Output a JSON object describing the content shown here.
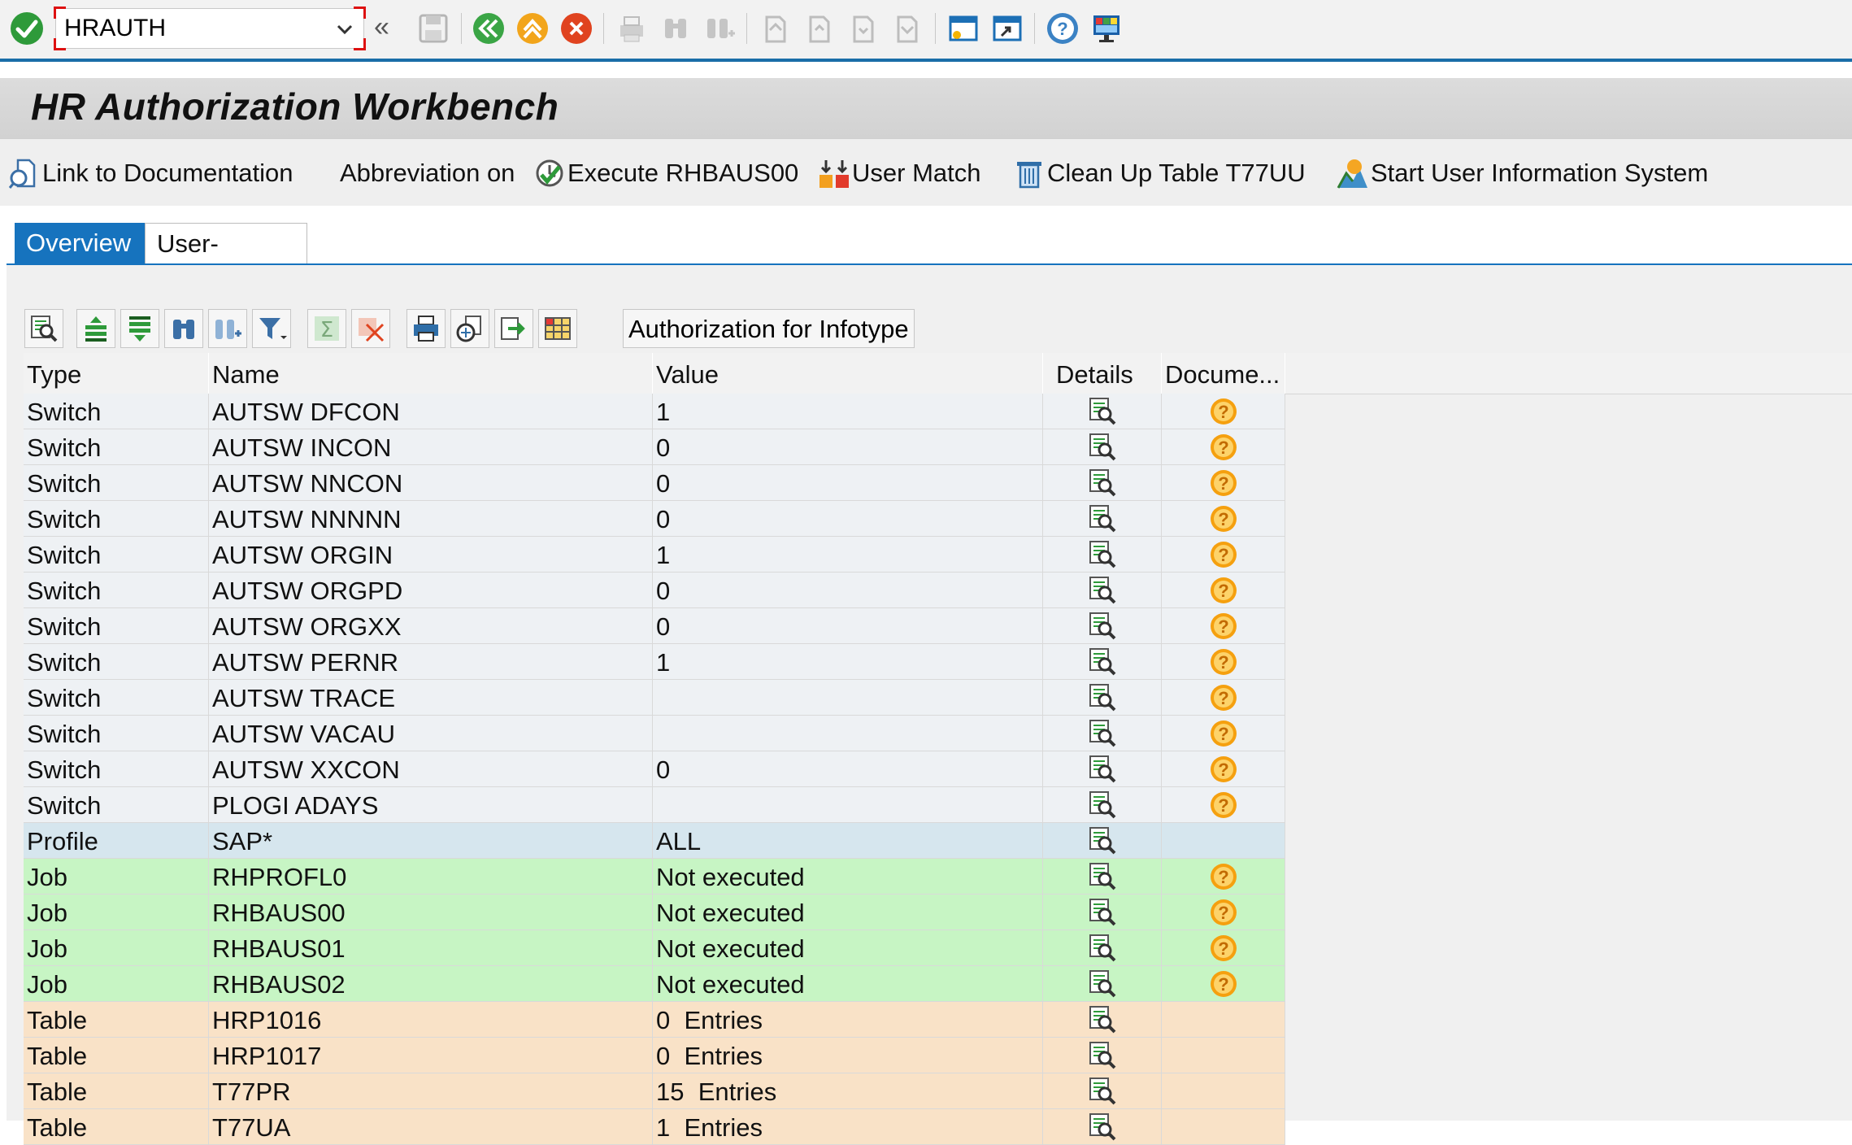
{
  "command_field": {
    "value": "HRAUTH"
  },
  "title": "HR Authorization Workbench",
  "app_toolbar": [
    {
      "label": "Link to Documentation",
      "icon": "link-doc-icon"
    },
    {
      "label": "Abbreviation on",
      "icon": ""
    },
    {
      "label": "Execute RHBAUS00",
      "icon": "execute-icon"
    },
    {
      "label": "User Match",
      "icon": "user-match-icon"
    },
    {
      "label": "Clean Up Table T77UU",
      "icon": "trash-icon"
    },
    {
      "label": "Start User Information System",
      "icon": "user-info-system-icon"
    }
  ],
  "tabs": [
    {
      "label": "Overview",
      "active": true
    },
    {
      "label": "User-specific",
      "active": false
    }
  ],
  "alv_toolbar": {
    "button_label": "Authorization for Infotype"
  },
  "grid": {
    "columns": [
      "Type",
      "Name",
      "Value",
      "Details",
      "Docume..."
    ],
    "rows": [
      {
        "type": "Switch",
        "name": "AUTSW DFCON",
        "value": "1",
        "doc": true,
        "status": "switch"
      },
      {
        "type": "Switch",
        "name": "AUTSW INCON",
        "value": "0",
        "doc": true,
        "status": "switch"
      },
      {
        "type": "Switch",
        "name": "AUTSW NNCON",
        "value": "0",
        "doc": true,
        "status": "switch"
      },
      {
        "type": "Switch",
        "name": "AUTSW NNNNN",
        "value": "0",
        "doc": true,
        "status": "switch"
      },
      {
        "type": "Switch",
        "name": "AUTSW ORGIN",
        "value": "1",
        "doc": true,
        "status": "switch"
      },
      {
        "type": "Switch",
        "name": "AUTSW ORGPD",
        "value": "0",
        "doc": true,
        "status": "switch"
      },
      {
        "type": "Switch",
        "name": "AUTSW ORGXX",
        "value": "0",
        "doc": true,
        "status": "switch"
      },
      {
        "type": "Switch",
        "name": "AUTSW PERNR",
        "value": "1",
        "doc": true,
        "status": "switch"
      },
      {
        "type": "Switch",
        "name": "AUTSW TRACE",
        "value": "",
        "doc": true,
        "status": "switch"
      },
      {
        "type": "Switch",
        "name": "AUTSW VACAU",
        "value": "",
        "doc": true,
        "status": "switch"
      },
      {
        "type": "Switch",
        "name": "AUTSW XXCON",
        "value": "0",
        "doc": true,
        "status": "switch"
      },
      {
        "type": "Switch",
        "name": "PLOGI ADAYS",
        "value": "",
        "doc": true,
        "status": "switch"
      },
      {
        "type": "Profile",
        "name": "SAP*",
        "value": "ALL",
        "doc": false,
        "status": "profile"
      },
      {
        "type": "Job",
        "name": "RHPROFL0",
        "value": "Not executed",
        "doc": true,
        "status": "job"
      },
      {
        "type": "Job",
        "name": "RHBAUS00",
        "value": "Not executed",
        "doc": true,
        "status": "job"
      },
      {
        "type": "Job",
        "name": "RHBAUS01",
        "value": "Not executed",
        "doc": true,
        "status": "job"
      },
      {
        "type": "Job",
        "name": "RHBAUS02",
        "value": "Not executed",
        "doc": true,
        "status": "job"
      },
      {
        "type": "Table",
        "name": "HRP1016",
        "value": "0  Entries",
        "doc": false,
        "status": "table"
      },
      {
        "type": "Table",
        "name": "HRP1017",
        "value": "0  Entries",
        "doc": false,
        "status": "table"
      },
      {
        "type": "Table",
        "name": "T77PR",
        "value": "15  Entries",
        "doc": false,
        "status": "table"
      },
      {
        "type": "Table",
        "name": "T77UA",
        "value": "1  Entries",
        "doc": false,
        "status": "table"
      }
    ]
  },
  "colors": {
    "accent": "#1673be",
    "switch_row": "#eef1f4",
    "profile_row": "#d6e6ee",
    "job_row": "#c7f5c4",
    "table_row": "#f9e2c7"
  }
}
